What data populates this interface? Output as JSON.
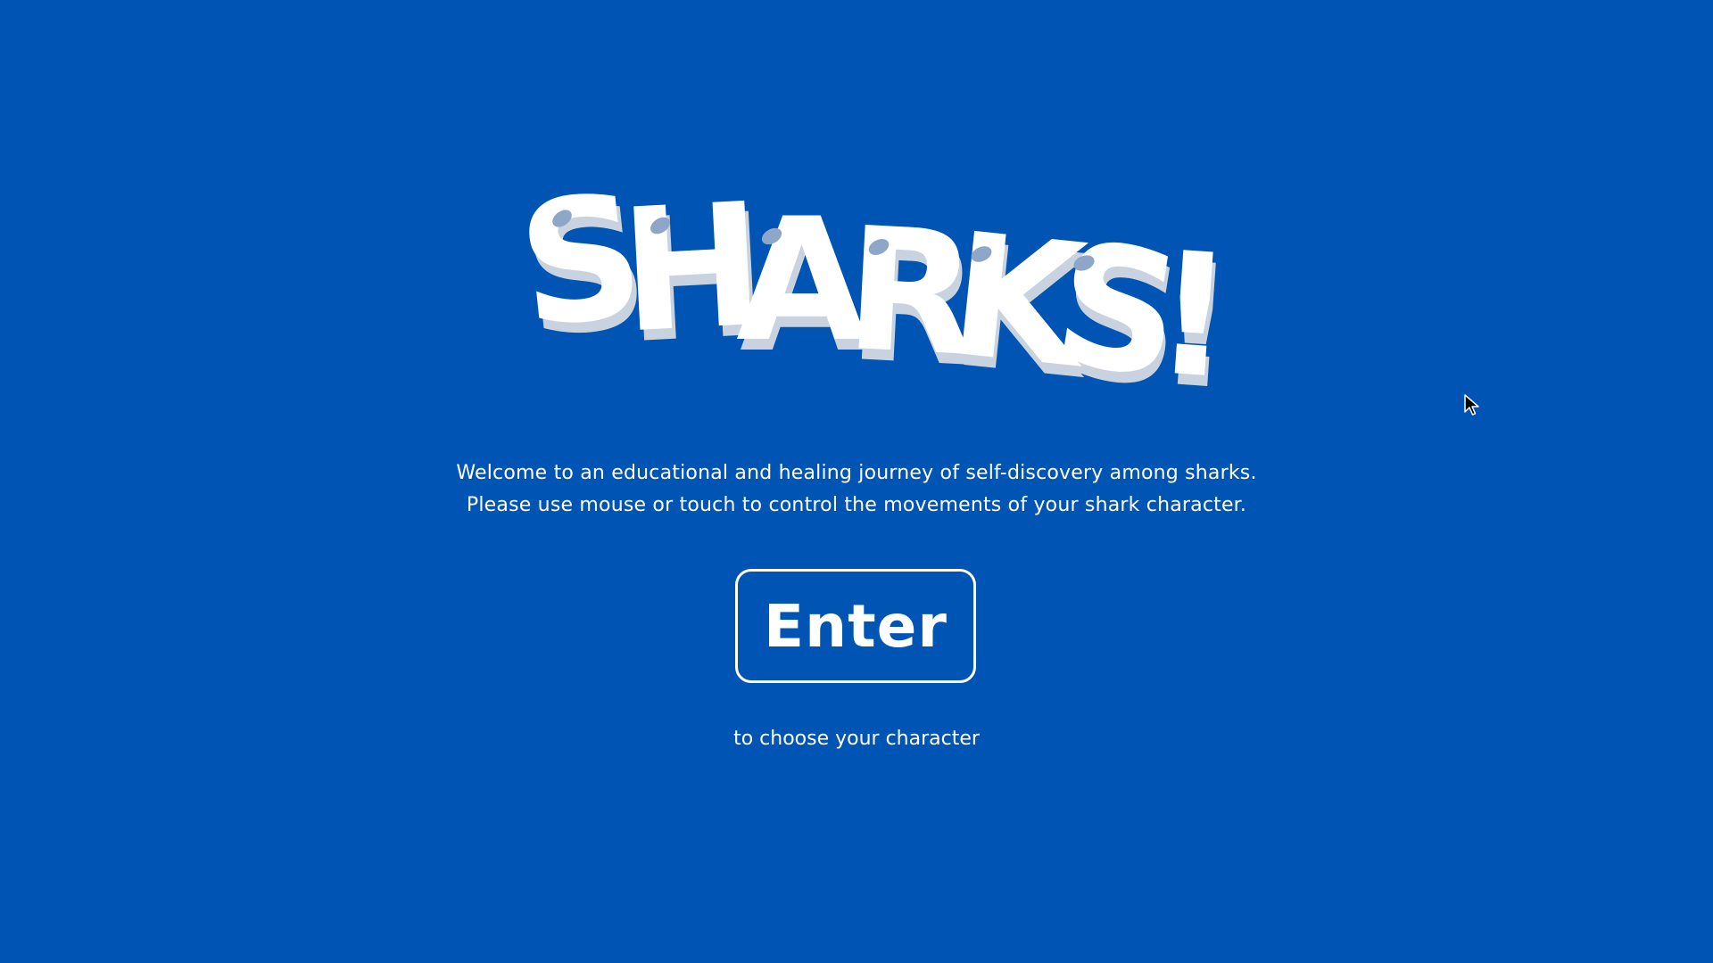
{
  "game": {
    "title": "SHARKS!",
    "title_letters": [
      "S",
      "H",
      "A",
      "R",
      "K",
      "S",
      "!"
    ],
    "intro_line1": "Welcome to an educational and healing journey of self-discovery among sharks.",
    "intro_line2": "Please use mouse or touch to control the movements of your shark character.",
    "enter_label": "Enter",
    "subtext": "to choose your character"
  },
  "colors": {
    "background": "#0054b4",
    "text": "#ffffff",
    "letter_shadow": "#c9d3e0"
  },
  "icons": {
    "cursor": "mouse-pointer-icon"
  }
}
